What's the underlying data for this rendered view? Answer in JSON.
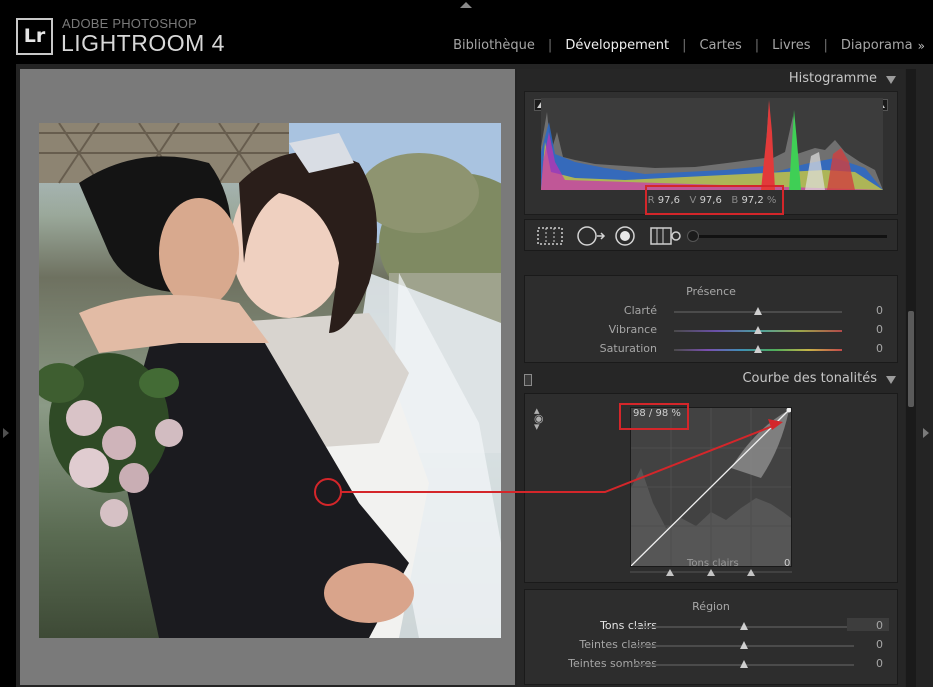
{
  "app": {
    "logo": "Lr",
    "brand_top": "ADOBE PHOTOSHOP",
    "brand_main": "LIGHTROOM 4"
  },
  "modules": [
    {
      "label": "Bibliothèque",
      "active": false
    },
    {
      "label": "Développement",
      "active": true
    },
    {
      "label": "Cartes",
      "active": false
    },
    {
      "label": "Livres",
      "active": false
    },
    {
      "label": "Diaporama",
      "active": false
    }
  ],
  "modules_more": "»",
  "histogram": {
    "title": "Histogramme",
    "readout": {
      "r_label": "R",
      "r": "97,6",
      "g_label": "V",
      "g": "97,6",
      "b_label": "B",
      "b": "97,2",
      "unit": "%"
    }
  },
  "presence": {
    "title": "Présence",
    "sliders": [
      {
        "label": "Clarté",
        "value": "0",
        "level": 0.5
      },
      {
        "label": "Vibrance",
        "value": "0",
        "level": 0.5
      },
      {
        "label": "Saturation",
        "value": "0",
        "level": 0.5
      }
    ]
  },
  "tone_curve": {
    "title": "Courbe des tonalités",
    "readout": "98 / 98 %",
    "region_label": "Tons clairs",
    "value": "0"
  },
  "region": {
    "title": "Région",
    "sliders": [
      {
        "label": "Tons clairs",
        "value": "0",
        "level": 0.5,
        "active": true
      },
      {
        "label": "Teintes claires",
        "value": "0",
        "level": 0.5,
        "active": false
      },
      {
        "label": "Teintes sombres",
        "value": "0",
        "level": 0.5,
        "active": false
      }
    ]
  },
  "colors": {
    "annotation": "#d4262a",
    "active_module": "#f0f0f0"
  }
}
